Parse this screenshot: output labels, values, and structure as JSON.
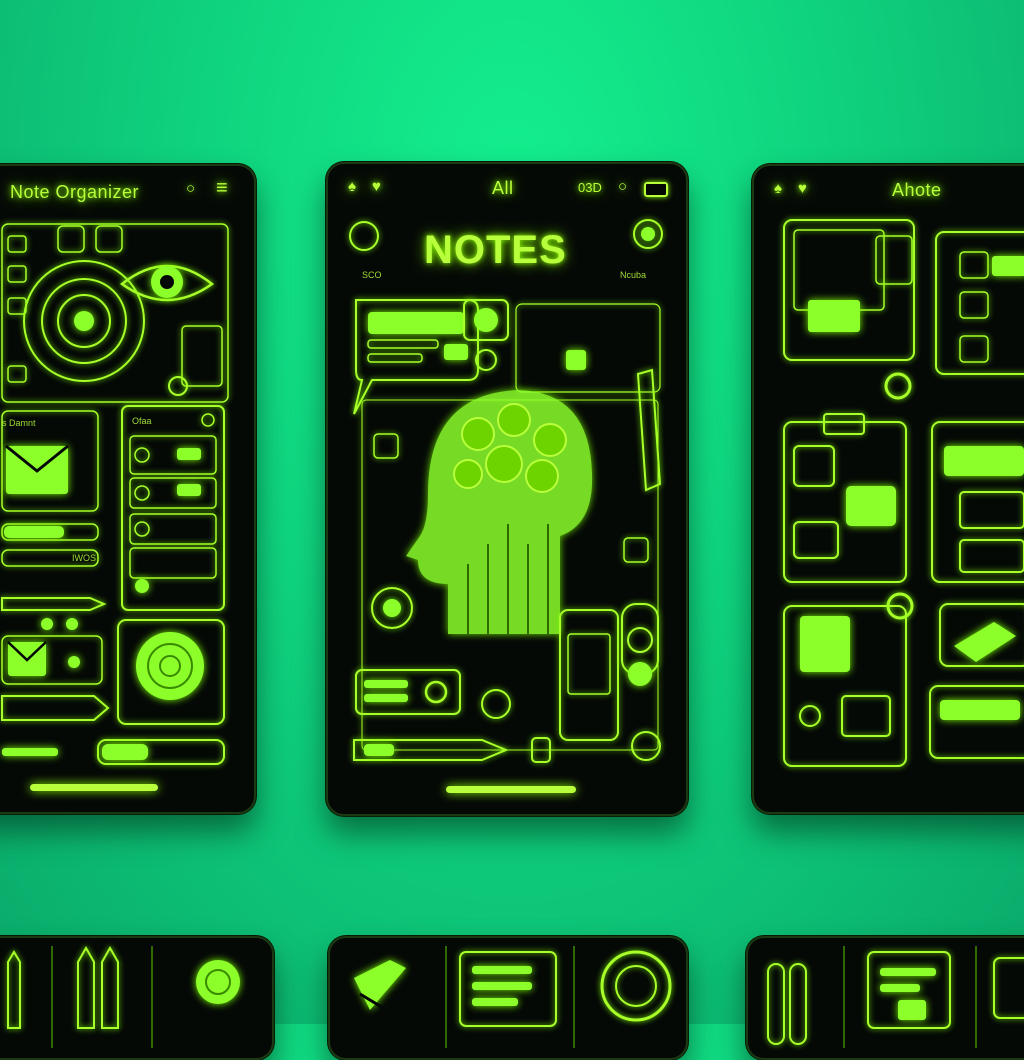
{
  "phones": {
    "left": {
      "title": "Note Organizer",
      "label_a": "s Damnt",
      "label_b": "Ofaa",
      "label_c": "IWOS"
    },
    "center": {
      "header": "All",
      "status": "03D",
      "title": "NOTES",
      "tag_a": "SCO",
      "tag_b": "Ncuba"
    },
    "right": {
      "title": "Ahote"
    }
  },
  "colors": {
    "background": "#0fd27e",
    "neon": "#b8ff3c",
    "panel": "#050906"
  },
  "icons": [
    "menu-icon",
    "bell-icon",
    "heart-icon",
    "battery-icon",
    "brain-icon",
    "eye-icon",
    "envelope-icon",
    "pencil-icon"
  ]
}
